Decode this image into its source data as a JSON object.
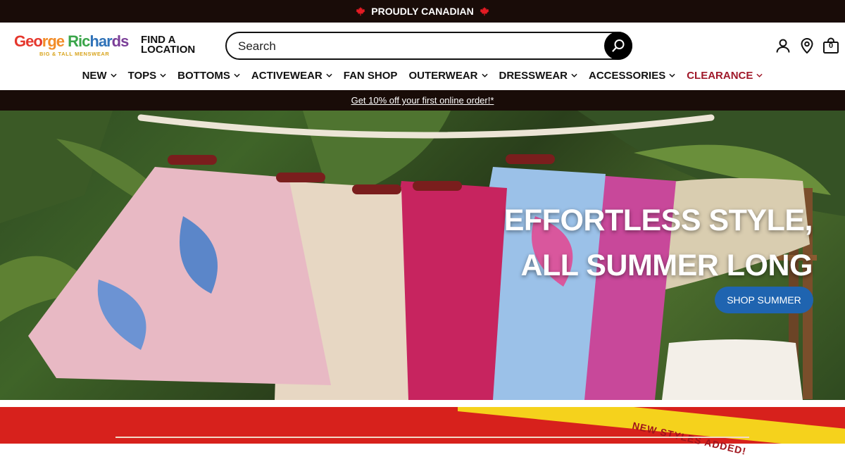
{
  "topbar": {
    "text": "PROUDLY CANADIAN"
  },
  "header": {
    "logo": {
      "name_parts": [
        "Geo",
        "rge ",
        "Ric",
        "har",
        "ds",
        ""
      ],
      "tagline": "BIG & TALL MENSWEAR"
    },
    "find_location": {
      "line1": "FIND A",
      "line2": "LOCATION"
    },
    "search": {
      "placeholder": "Search"
    },
    "cart_count": "0"
  },
  "nav": {
    "items": [
      {
        "label": "NEW",
        "dropdown": true
      },
      {
        "label": "TOPS",
        "dropdown": true
      },
      {
        "label": "BOTTOMS",
        "dropdown": true
      },
      {
        "label": "ACTIVEWEAR",
        "dropdown": true
      },
      {
        "label": "FAN SHOP",
        "dropdown": false
      },
      {
        "label": "OUTERWEAR",
        "dropdown": true
      },
      {
        "label": "DRESSWEAR",
        "dropdown": true
      },
      {
        "label": "ACCESSORIES",
        "dropdown": true
      },
      {
        "label": "CLEARANCE",
        "dropdown": true
      }
    ]
  },
  "promo": {
    "text": "Get 10% off your first online order!*"
  },
  "hero": {
    "headline_line1": "EFFORTLESS STYLE,",
    "headline_line2": "ALL SUMMER LONG",
    "cta": "SHOP SUMMER"
  },
  "sale_banner": {
    "ribbon_text": "NEW STYLES ADDED!"
  },
  "colors": {
    "topbar_bg": "#190c08",
    "cta_blue": "#1f64b0",
    "clearance_red": "#a0192a",
    "banner_red": "#d7211c"
  }
}
